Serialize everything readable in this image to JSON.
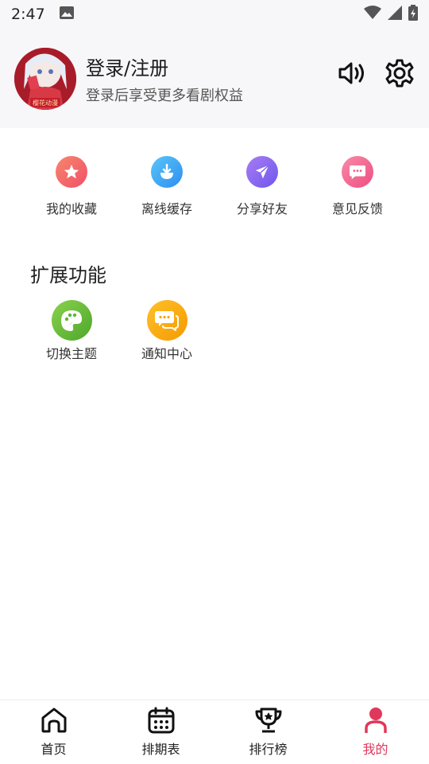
{
  "status_bar": {
    "time": "2:47"
  },
  "header": {
    "login_title": "登录/注册",
    "login_subtitle": "登录后享受更多看剧权益",
    "avatar_caption": "樱花动漫"
  },
  "quick_actions": [
    {
      "label": "我的收藏",
      "icon": "star-icon",
      "color": "#f36a5f"
    },
    {
      "label": "离线缓存",
      "icon": "download-icon",
      "color": "#3fa9f5"
    },
    {
      "label": "分享好友",
      "icon": "share-icon",
      "color": "#8b6cf2"
    },
    {
      "label": "意见反馈",
      "icon": "feedback-icon",
      "color": "#f0568b"
    }
  ],
  "extensions": {
    "title": "扩展功能",
    "items": [
      {
        "label": "切换主题",
        "icon": "palette-icon",
        "color": "#6bbf3a"
      },
      {
        "label": "通知中心",
        "icon": "notification-icon",
        "color": "#f7a800"
      }
    ]
  },
  "bottom_nav": {
    "items": [
      {
        "label": "首页",
        "icon": "home-icon"
      },
      {
        "label": "排期表",
        "icon": "calendar-icon"
      },
      {
        "label": "排行榜",
        "icon": "trophy-icon"
      },
      {
        "label": "我的",
        "icon": "profile-icon",
        "active": true
      }
    ]
  },
  "colors": {
    "accent": "#e0385a",
    "header_bg": "#f7f7f9"
  }
}
